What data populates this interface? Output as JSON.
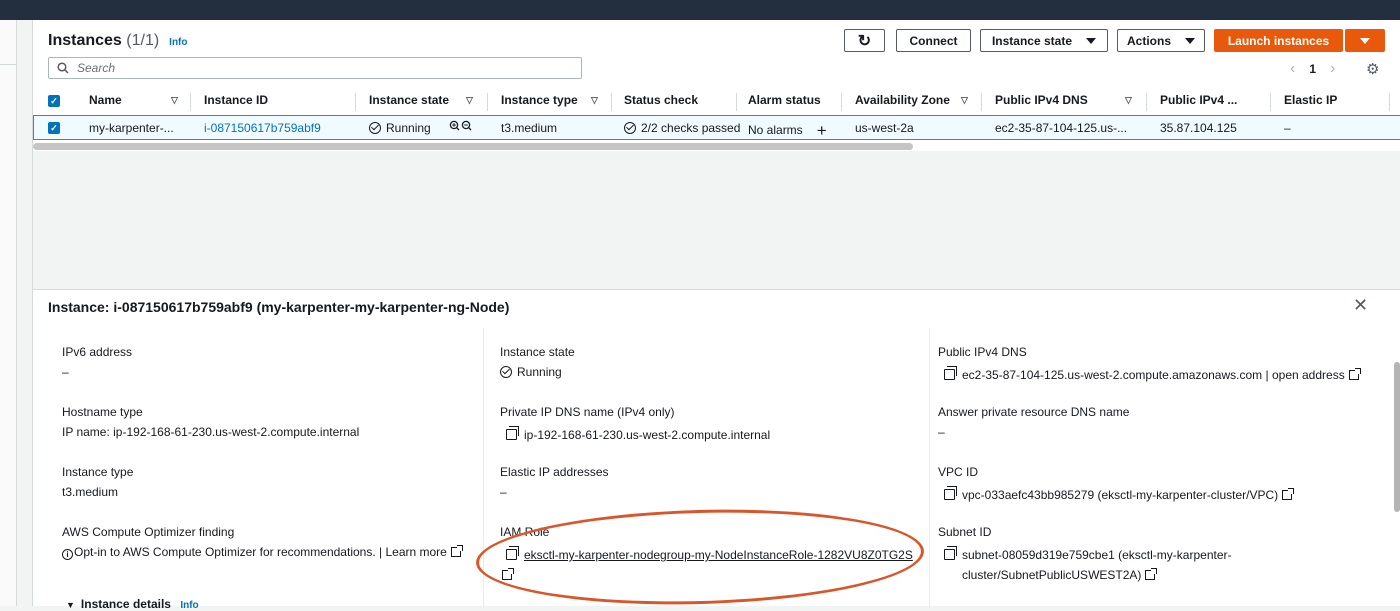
{
  "header": {
    "title": "Instances",
    "count": "(1/1)",
    "info": "Info"
  },
  "buttons": {
    "refresh_icon": "↻",
    "connect": "Connect",
    "instance_state": "Instance state",
    "actions": "Actions",
    "launch": "Launch instances"
  },
  "search": {
    "placeholder": "Search",
    "icon": "search-icon"
  },
  "pagination": {
    "page": "1",
    "prev": "‹",
    "next": "›"
  },
  "settings_icon": "⚙",
  "table": {
    "columns": [
      "Name",
      "Instance ID",
      "Instance state",
      "Instance type",
      "Status check",
      "Alarm status",
      "Availability Zone",
      "Public IPv4 DNS",
      "Public IPv4 ...",
      "Elastic IP"
    ],
    "row": {
      "name": "my-karpenter-...",
      "instance_id": "i-087150617b759abf9",
      "state": "Running",
      "type": "t3.medium",
      "status_check": "2/2 checks passed",
      "alarm": "No alarms",
      "az": "us-west-2a",
      "dns": "ec2-35-87-104-125.us-...",
      "ipv4": "35.87.104.125",
      "eip": "–"
    }
  },
  "details": {
    "title": "Instance: i-087150617b759abf9 (my-karpenter-my-karpenter-ng-Node)",
    "close": "✕",
    "divider": "=",
    "col1": {
      "ipv6_label": "IPv6 address",
      "ipv6_value": "–",
      "hostname_label": "Hostname type",
      "hostname_value": "IP name: ip-192-168-61-230.us-west-2.compute.internal",
      "type_label": "Instance type",
      "type_value": "t3.medium",
      "optimizer_label": "AWS Compute Optimizer finding",
      "optimizer_value": "Opt-in to AWS Compute Optimizer for recommendations.",
      "optimizer_sep": "|",
      "optimizer_link": "Learn more"
    },
    "col2": {
      "state_label": "Instance state",
      "state_value": "Running",
      "private_dns_label": "Private IP DNS name (IPv4 only)",
      "private_dns_value": "ip-192-168-61-230.us-west-2.compute.internal",
      "eip_label": "Elastic IP addresses",
      "eip_value": "–",
      "iam_label": "IAM Role",
      "iam_value": "eksctl-my-karpenter-nodegroup-my-NodeInstanceRole-1282VU8Z0TG2S"
    },
    "col3": {
      "public_dns_label": "Public IPv4 DNS",
      "public_dns_value": "ec2-35-87-104-125.us-west-2.compute.amazonaws.com",
      "public_dns_sep": "|",
      "public_dns_link": "open address",
      "answer_dns_label": "Answer private resource DNS name",
      "answer_dns_value": "–",
      "vpc_label": "VPC ID",
      "vpc_value": "vpc-033aefc43bb985279 (eksctl-my-karpenter-cluster/VPC)",
      "subnet_label": "Subnet ID",
      "subnet_value_1": "subnet-08059d319e759cbe1 (eksctl-my-karpenter-",
      "subnet_value_2": "cluster/SubnetPublicUSWEST2A)"
    },
    "section": {
      "label": "Instance details",
      "info": "Info"
    }
  },
  "colors": {
    "accent": "#0073bb",
    "brand_orange": "#e8590c",
    "annotation": "#d9562b"
  }
}
